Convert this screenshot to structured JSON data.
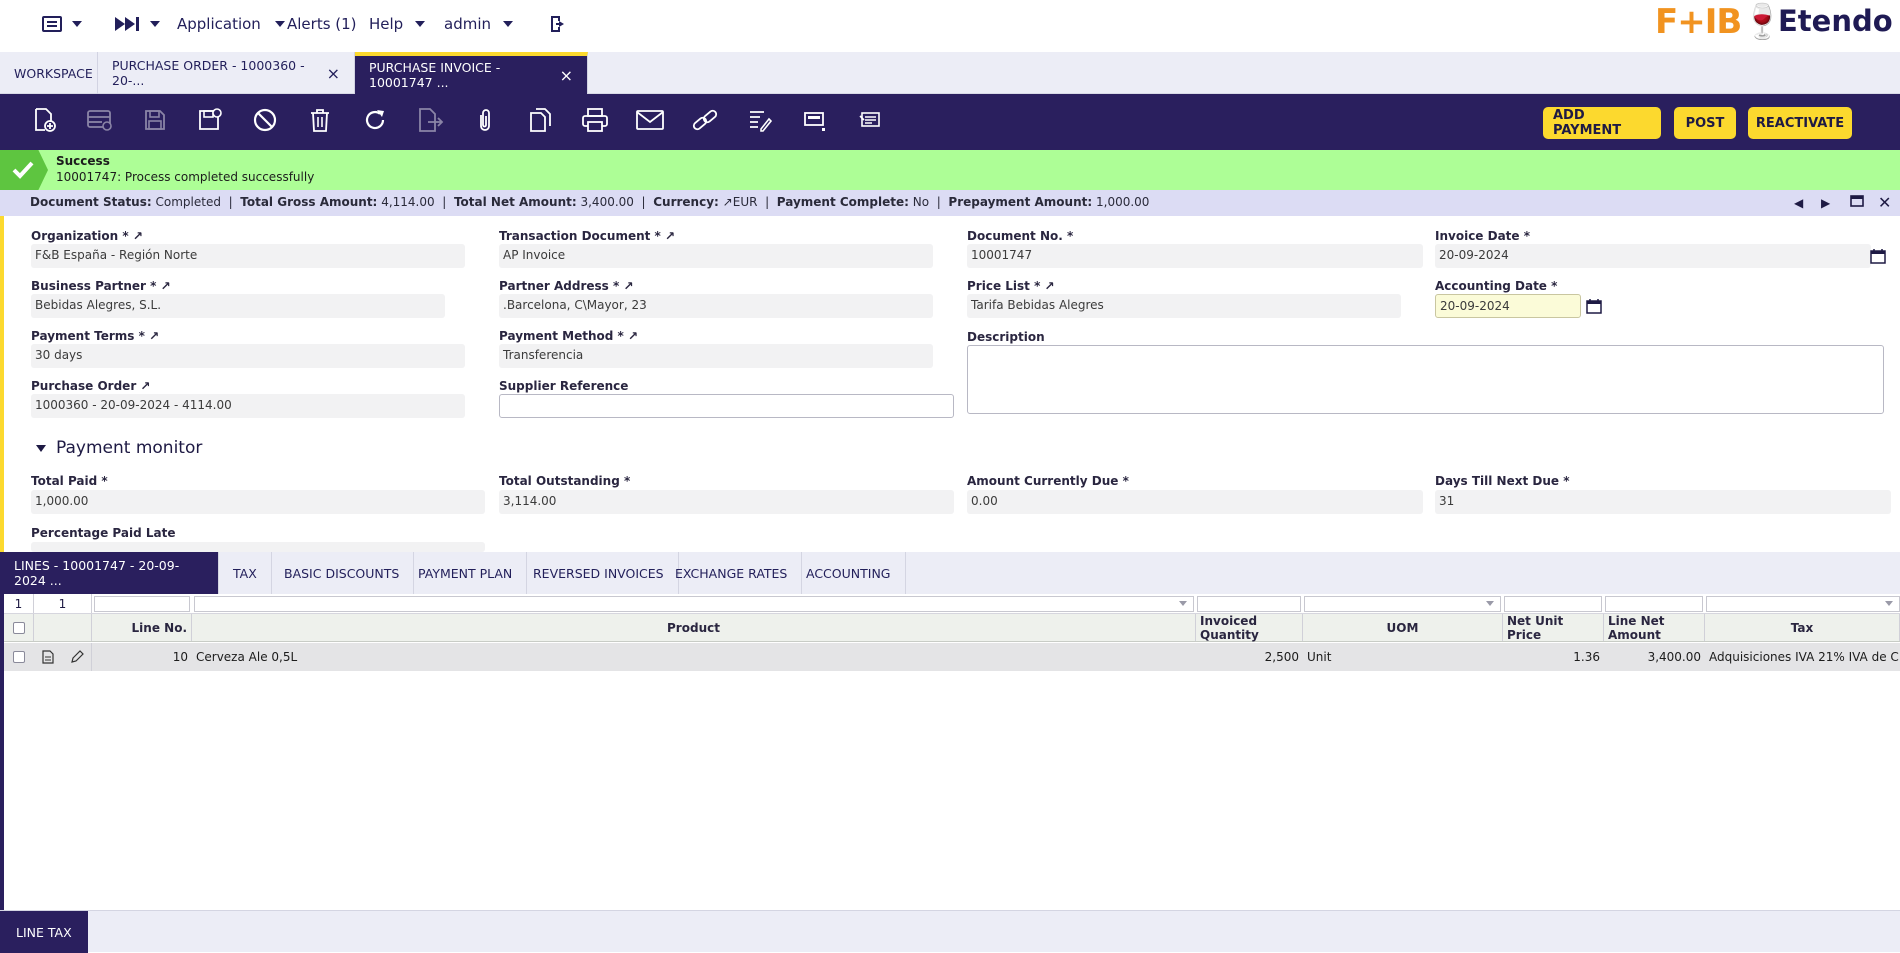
{
  "topbar": {
    "menu_icon": "list-menu-icon",
    "quicklaunch_icon": "fast-forward-icon",
    "application": "Application",
    "alerts": "Alerts (1)",
    "help": "Help",
    "user": "admin",
    "logout_icon": "logout-icon",
    "brand_left": "F+IB🍷",
    "brand_right": "Etendo"
  },
  "tabs": [
    {
      "label": "WORKSPACE"
    },
    {
      "label": "PURCHASE ORDER - 1000360 - 20-...",
      "close": "×"
    },
    {
      "label": "PURCHASE INVOICE - 10001747 ...",
      "close": "×"
    }
  ],
  "toolbar": {
    "add_payment": "ADD PAYMENT",
    "post": "POST",
    "reactivate": "REACTIVATE",
    "icons": [
      "new-document-icon",
      "new-row-icon",
      "save-icon",
      "save-close-icon",
      "undo-icon",
      "delete-icon",
      "refresh-icon",
      "export-icon",
      "attach-icon",
      "copy-icon",
      "print-icon",
      "email-icon",
      "link-icon",
      "audit-icon",
      "grid-view-icon",
      "notes-icon"
    ]
  },
  "message": {
    "title": "Success",
    "text": "10001747: Process completed successfully"
  },
  "status": {
    "doc_status_label": "Document Status:",
    "doc_status": "Completed",
    "gross_label": "Total Gross Amount:",
    "gross": "4,114.00",
    "net_label": "Total Net Amount:",
    "net": "3,400.00",
    "currency_label": "Currency:",
    "currency": "EUR",
    "payment_complete_label": "Payment Complete:",
    "payment_complete": "No",
    "prepayment_label": "Prepayment Amount:",
    "prepayment": "1,000.00"
  },
  "form": {
    "organization_label": "Organization *",
    "organization": "F&B España - Región Norte",
    "transaction_document_label": "Transaction Document *",
    "transaction_document": "AP Invoice",
    "document_no_label": "Document No. *",
    "document_no": "10001747",
    "invoice_date_label": "Invoice Date *",
    "invoice_date": "20-09-2024",
    "business_partner_label": "Business Partner *",
    "business_partner": "Bebidas Alegres, S.L.",
    "partner_address_label": "Partner Address *",
    "partner_address": ".Barcelona, C\\Mayor, 23",
    "price_list_label": "Price List *",
    "price_list": "Tarifa Bebidas Alegres",
    "accounting_date_label": "Accounting Date *",
    "accounting_date": "20-09-2024",
    "payment_terms_label": "Payment Terms *",
    "payment_terms": "30 days",
    "payment_method_label": "Payment Method *",
    "payment_method": "Transferencia",
    "description_label": "Description",
    "description": "",
    "purchase_order_label": "Purchase Order",
    "purchase_order": "1000360 - 20-09-2024 - 4114.00",
    "supplier_reference_label": "Supplier Reference",
    "supplier_reference": ""
  },
  "payment_monitor": {
    "title": "Payment monitor",
    "total_paid_label": "Total Paid *",
    "total_paid": "1,000.00",
    "total_outstanding_label": "Total Outstanding *",
    "total_outstanding": "3,114.00",
    "amount_due_label": "Amount Currently Due *",
    "amount_due": "0.00",
    "days_next_due_label": "Days Till Next Due *",
    "days_next_due": "31",
    "percentage_paid_late_label": "Percentage Paid Late"
  },
  "child_tabs": [
    {
      "label": "LINES - 10001747 - 20-09-2024 ..."
    },
    {
      "label": "TAX"
    },
    {
      "label": "BASIC DISCOUNTS"
    },
    {
      "label": "PAYMENT PLAN"
    },
    {
      "label": "REVERSED INVOICES"
    },
    {
      "label": "EXCHANGE RATES"
    },
    {
      "label": "ACCOUNTING"
    }
  ],
  "grid": {
    "counts": [
      "1",
      "1"
    ],
    "columns": {
      "line_no": "Line No.",
      "product": "Product",
      "invoiced_qty": "Invoiced Quantity",
      "uom": "UOM",
      "net_unit_price": "Net Unit Price",
      "line_net_amount": "Line Net Amount",
      "tax": "Tax"
    },
    "rows": [
      {
        "line_no": "10",
        "product": "Cerveza Ale 0,5L",
        "invoiced_qty": "2,500",
        "uom": "Unit",
        "net_unit_price": "1.36",
        "line_net_amount": "3,400.00",
        "tax": "Adquisiciones IVA 21% IVA de C..."
      }
    ]
  },
  "bottom_tabs": [
    {
      "label": "LINE TAX"
    }
  ]
}
